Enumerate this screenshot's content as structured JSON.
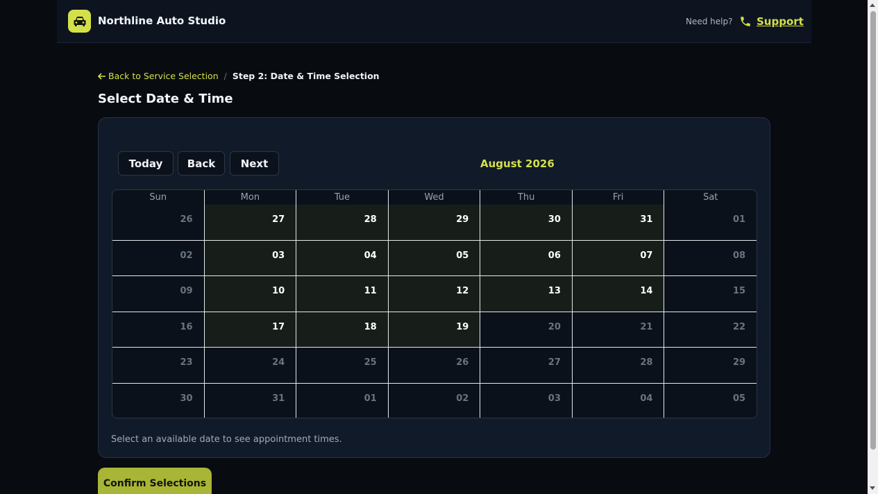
{
  "header": {
    "brand": "Northline Auto Studio",
    "help_text": "Need help?",
    "support_label": "Support",
    "accent": "#d4e04a"
  },
  "breadcrumb": {
    "back_label": "Back to Service Selection",
    "separator": "/",
    "current": "Step 2: Date & Time Selection"
  },
  "page_title": "Select Date & Time",
  "calendar": {
    "today_label": "Today",
    "back_label": "Back",
    "next_label": "Next",
    "month_label": "August 2026",
    "weekdays": [
      "Sun",
      "Mon",
      "Tue",
      "Wed",
      "Thu",
      "Fri",
      "Sat"
    ],
    "weeks": [
      [
        {
          "d": "26",
          "a": false
        },
        {
          "d": "27",
          "a": true
        },
        {
          "d": "28",
          "a": true
        },
        {
          "d": "29",
          "a": true
        },
        {
          "d": "30",
          "a": true
        },
        {
          "d": "31",
          "a": true
        },
        {
          "d": "01",
          "a": false
        }
      ],
      [
        {
          "d": "02",
          "a": false
        },
        {
          "d": "03",
          "a": true
        },
        {
          "d": "04",
          "a": true
        },
        {
          "d": "05",
          "a": true
        },
        {
          "d": "06",
          "a": true
        },
        {
          "d": "07",
          "a": true
        },
        {
          "d": "08",
          "a": false
        }
      ],
      [
        {
          "d": "09",
          "a": false
        },
        {
          "d": "10",
          "a": true
        },
        {
          "d": "11",
          "a": true
        },
        {
          "d": "12",
          "a": true
        },
        {
          "d": "13",
          "a": true
        },
        {
          "d": "14",
          "a": true
        },
        {
          "d": "15",
          "a": false
        }
      ],
      [
        {
          "d": "16",
          "a": false
        },
        {
          "d": "17",
          "a": true
        },
        {
          "d": "18",
          "a": true
        },
        {
          "d": "19",
          "a": true
        },
        {
          "d": "20",
          "a": false
        },
        {
          "d": "21",
          "a": false
        },
        {
          "d": "22",
          "a": false
        }
      ],
      [
        {
          "d": "23",
          "a": false
        },
        {
          "d": "24",
          "a": false
        },
        {
          "d": "25",
          "a": false
        },
        {
          "d": "26",
          "a": false
        },
        {
          "d": "27",
          "a": false
        },
        {
          "d": "28",
          "a": false
        },
        {
          "d": "29",
          "a": false
        }
      ],
      [
        {
          "d": "30",
          "a": false
        },
        {
          "d": "31",
          "a": false
        },
        {
          "d": "01",
          "a": false
        },
        {
          "d": "02",
          "a": false
        },
        {
          "d": "03",
          "a": false
        },
        {
          "d": "04",
          "a": false
        },
        {
          "d": "05",
          "a": false
        }
      ]
    ],
    "hint": "Select an available date to see appointment times."
  },
  "confirm_label": "Confirm Selections"
}
